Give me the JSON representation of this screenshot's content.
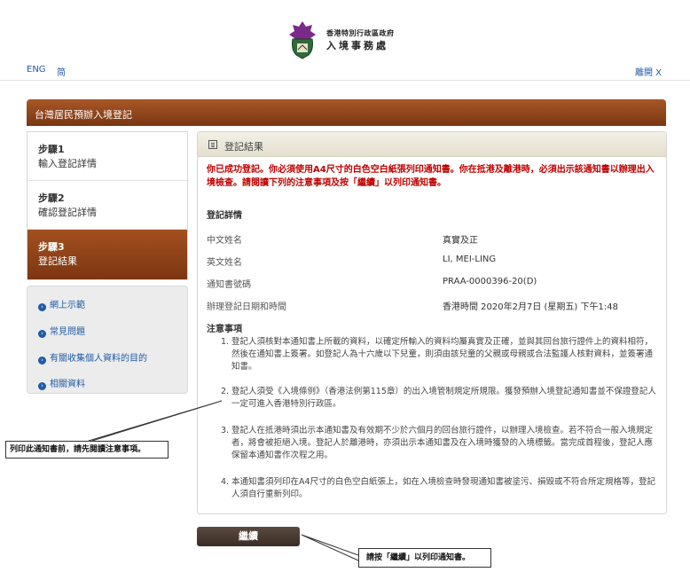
{
  "header": {
    "logo_line1": "香港特別行政區政府",
    "logo_line2": "入境事務處",
    "lang_eng": "ENG",
    "lang_sc": "简",
    "exit": "離開 X"
  },
  "banner": {
    "title": "台灣居民預辦入境登記"
  },
  "steps": [
    {
      "num": "步驟1",
      "label": "輸入登記詳情"
    },
    {
      "num": "步驟2",
      "label": "確認登記詳情"
    },
    {
      "num": "步驟3",
      "label": "登記結果"
    }
  ],
  "links": [
    "網上示範",
    "常見問題",
    "有關收集個人資料的目的",
    "相關資料"
  ],
  "panel": {
    "title": "登記結果",
    "success": "你已成功登記。你必須使用A4尺寸的白色空白紙張列印通知書。你在抵港及離港時，必須出示該通知書以辦理出入境檢查。請閱讀下列的注意事項及按「繼續」以列印通知書。",
    "details_heading": "登記詳情",
    "rows": [
      {
        "label": "中文姓名",
        "value": "真實及正"
      },
      {
        "label": "英文姓名",
        "value": "LI, MEI-LING"
      },
      {
        "label": "通知書號碼",
        "value": "PRAA-0000396-20(D)"
      },
      {
        "label": "辦理登記日期和時間",
        "value": "香港時間 2020年2月7日 (星期五) 下午1:48"
      }
    ],
    "notes_heading": "注意事項",
    "notes": [
      "登記人須核對本通知書上所載的資料，以確定所輸入的資料均屬真實及正確，並與其回台旅行證件上的資料相符，然後在通知書上簽署。如登記人為十六歲以下兒童，則須由該兒童的父親或母親或合法監護人核對資料，並簽署通知書。",
      "登記人須受《入境條例》（香港法例第115章）的出入境管制規定所規限。獲發預辦入境登記通知書並不保證登記人一定可進入香港特別行政區。",
      "登記人在抵港時須出示本通知書及有效期不少於六個月的回台旅行證件，以辦理入境檢查。若不符合一般入境規定者，將會被拒絕入境。登記人於離港時，亦須出示本通知書及在入境時獲發的入境標籤。當完成首程後，登記人應保留本通知書作次程之用。",
      "本通知書須列印在A4尺寸的白色空白紙張上，如在入境檢查時發現通知書被塗污、損毀或不符合所定規格等，登記人須自行重新列印。"
    ]
  },
  "continue_label": "繼續",
  "callouts": {
    "left": "列印此通知書前，請先閱讀注意事項。",
    "right": "請按「繼續」以列印通知書。"
  }
}
